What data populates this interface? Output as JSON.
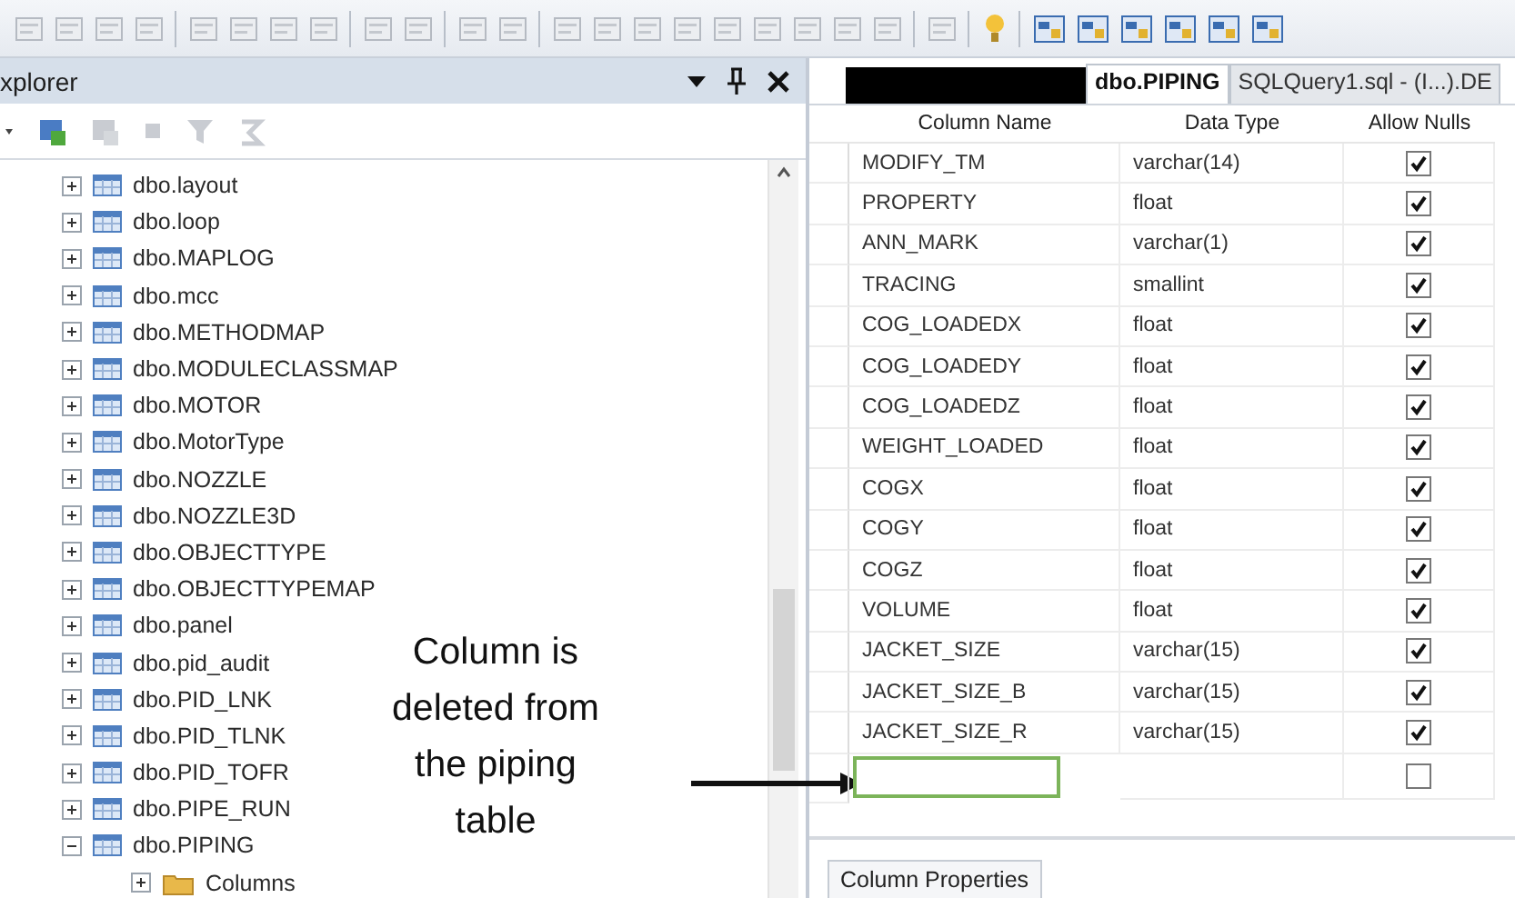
{
  "explorer": {
    "title": "xplorer",
    "tree": [
      {
        "label": "dbo.layout",
        "expanded": false
      },
      {
        "label": "dbo.loop",
        "expanded": false
      },
      {
        "label": "dbo.MAPLOG",
        "expanded": false
      },
      {
        "label": "dbo.mcc",
        "expanded": false
      },
      {
        "label": "dbo.METHODMAP",
        "expanded": false
      },
      {
        "label": "dbo.MODULECLASSMAP",
        "expanded": false
      },
      {
        "label": "dbo.MOTOR",
        "expanded": false
      },
      {
        "label": "dbo.MotorType",
        "expanded": false
      },
      {
        "label": "dbo.NOZZLE",
        "expanded": false
      },
      {
        "label": "dbo.NOZZLE3D",
        "expanded": false
      },
      {
        "label": "dbo.OBJECTTYPE",
        "expanded": false
      },
      {
        "label": "dbo.OBJECTTYPEMAP",
        "expanded": false
      },
      {
        "label": "dbo.panel",
        "expanded": false
      },
      {
        "label": "dbo.pid_audit",
        "expanded": false
      },
      {
        "label": "dbo.PID_LNK",
        "expanded": false
      },
      {
        "label": "dbo.PID_TLNK",
        "expanded": false
      },
      {
        "label": "dbo.PID_TOFR",
        "expanded": false
      },
      {
        "label": "dbo.PIPE_RUN",
        "expanded": false
      },
      {
        "label": "dbo.PIPING",
        "expanded": true,
        "children": [
          {
            "label": "Columns",
            "expanded": false
          }
        ]
      }
    ]
  },
  "designer": {
    "tabs": [
      {
        "label": "dbo.PIPING",
        "selected": true
      },
      {
        "label": "SQLQuery1.sql - (I...).DE",
        "selected": false
      }
    ],
    "columns": [
      "Column Name",
      "Data Type",
      "Allow Nulls"
    ],
    "rows": [
      {
        "name": "MODIFY_TM",
        "type": "varchar(14)",
        "allow_nulls": true
      },
      {
        "name": "PROPERTY",
        "type": "float",
        "allow_nulls": true
      },
      {
        "name": "ANN_MARK",
        "type": "varchar(1)",
        "allow_nulls": true
      },
      {
        "name": "TRACING",
        "type": "smallint",
        "allow_nulls": true
      },
      {
        "name": "COG_LOADEDX",
        "type": "float",
        "allow_nulls": true
      },
      {
        "name": "COG_LOADEDY",
        "type": "float",
        "allow_nulls": true
      },
      {
        "name": "COG_LOADEDZ",
        "type": "float",
        "allow_nulls": true
      },
      {
        "name": "WEIGHT_LOADED",
        "type": "float",
        "allow_nulls": true
      },
      {
        "name": "COGX",
        "type": "float",
        "allow_nulls": true
      },
      {
        "name": "COGY",
        "type": "float",
        "allow_nulls": true
      },
      {
        "name": "COGZ",
        "type": "float",
        "allow_nulls": true
      },
      {
        "name": "VOLUME",
        "type": "float",
        "allow_nulls": true
      },
      {
        "name": "JACKET_SIZE",
        "type": "varchar(15)",
        "allow_nulls": true
      },
      {
        "name": "JACKET_SIZE_B",
        "type": "varchar(15)",
        "allow_nulls": true
      },
      {
        "name": "JACKET_SIZE_R",
        "type": "varchar(15)",
        "allow_nulls": true
      }
    ],
    "new_row": {
      "allow_nulls": false
    },
    "properties_tab": "Column Properties"
  },
  "callout": "Column is deleted from the piping table"
}
